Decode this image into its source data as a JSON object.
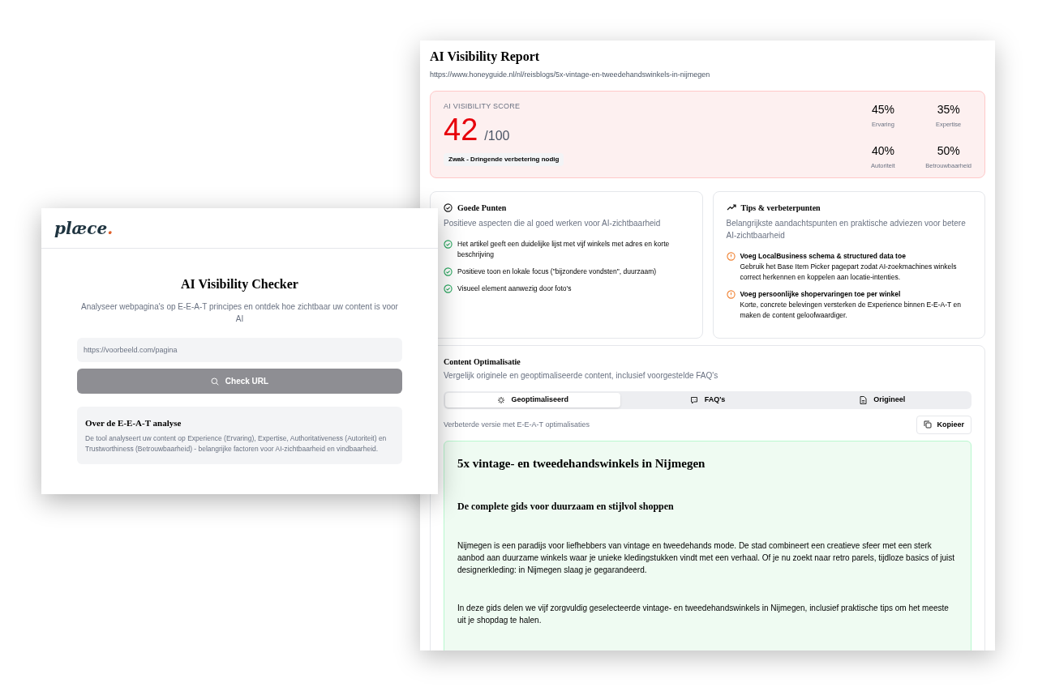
{
  "report": {
    "title": "AI Visibility Report",
    "url": "https://www.honeyguide.nl/nl/reisblogs/5x-vintage-en-tweedehandswinkels-in-nijmegen",
    "score": {
      "label": "AI VISIBILITY SCORE",
      "value": "42",
      "max": "/100",
      "rating": "Zwak - Dringende verbetering nodig"
    },
    "metrics": [
      {
        "value": "45%",
        "label": "Ervaring"
      },
      {
        "value": "35%",
        "label": "Expertise"
      },
      {
        "value": "40%",
        "label": "Autoriteit"
      },
      {
        "value": "50%",
        "label": "Betrouwbaarheid"
      }
    ],
    "good_points": {
      "title": "Goede Punten",
      "subtitle": "Positieve aspecten die al goed werken voor AI-zichtbaarheid",
      "items": [
        "Het artikel geeft een duidelijke lijst met vijf winkels met adres en korte beschrijving",
        "Positieve toon en lokale focus (\"bijzondere vondsten\", duurzaam)",
        "Visueel element aanwezig door foto's"
      ]
    },
    "tips": {
      "title": "Tips & verbeterpunten",
      "subtitle": "Belangrijkste aandachtspunten en praktische adviezen voor betere AI-zichtbaarheid",
      "items": [
        {
          "title": "Voeg LocalBusiness schema & structured data toe",
          "text": "Gebruik het Base Item Picker pagepart zodat AI-zoekmachines winkels correct herkennen en koppelen aan locatie-intenties."
        },
        {
          "title": "Voeg persoonlijke shopervaringen toe per winkel",
          "text": "Korte, concrete belevingen versterken de Experience binnen E-E-A-T en maken de content geloofwaardiger."
        }
      ]
    },
    "content": {
      "title": "Content Optimalisatie",
      "subtitle": "Vergelijk originele en geoptimaliseerde content, inclusief voorgestelde FAQ's",
      "tabs": [
        {
          "label": "Geoptimaliseerd",
          "selected": true
        },
        {
          "label": "FAQ's",
          "selected": false
        },
        {
          "label": "Origineel",
          "selected": false
        }
      ],
      "caption": "Verbeterde versie met E-E-A-T optimalisaties",
      "copy_button": "Kopieer",
      "article": {
        "heading": "5x vintage- en tweedehandswinkels in Nijmegen",
        "subheading": "De complete gids voor duurzaam en stijlvol shoppen",
        "paragraphs": [
          "Nijmegen is een paradijs voor liefhebbers van vintage en tweedehands mode. De stad combineert een creatieve sfeer met een sterk aanbod aan duurzame winkels waar je unieke kledingstukken vindt met een verhaal. Of je nu zoekt naar retro parels, tijdloze basics of juist designerkleding: in Nijmegen slaag je gegarandeerd.",
          "In deze gids delen we vijf zorgvuldig geselecteerde vintage- en tweedehandswinkels in Nijmegen, inclusief praktische tips om het meeste uit je shopdag te halen."
        ]
      }
    }
  },
  "checker": {
    "logo": "plæce.",
    "title": "AI Visibility Checker",
    "subtitle": "Analyseer webpagina's op E-E-A-T principes en ontdek hoe zichtbaar uw content is voor AI",
    "url_placeholder": "https://voorbeeld.com/pagina",
    "button": "Check URL",
    "about": {
      "title": "Over de E-E-A-T analyse",
      "text": "De tool analyseert uw content op Experience (Ervaring), Expertise, Authoritativeness (Autoriteit) en Trustworthiness (Betrouwbaarheid) - belangrijke factoren voor AI-zichtbaarheid en vindbaarheid."
    }
  }
}
